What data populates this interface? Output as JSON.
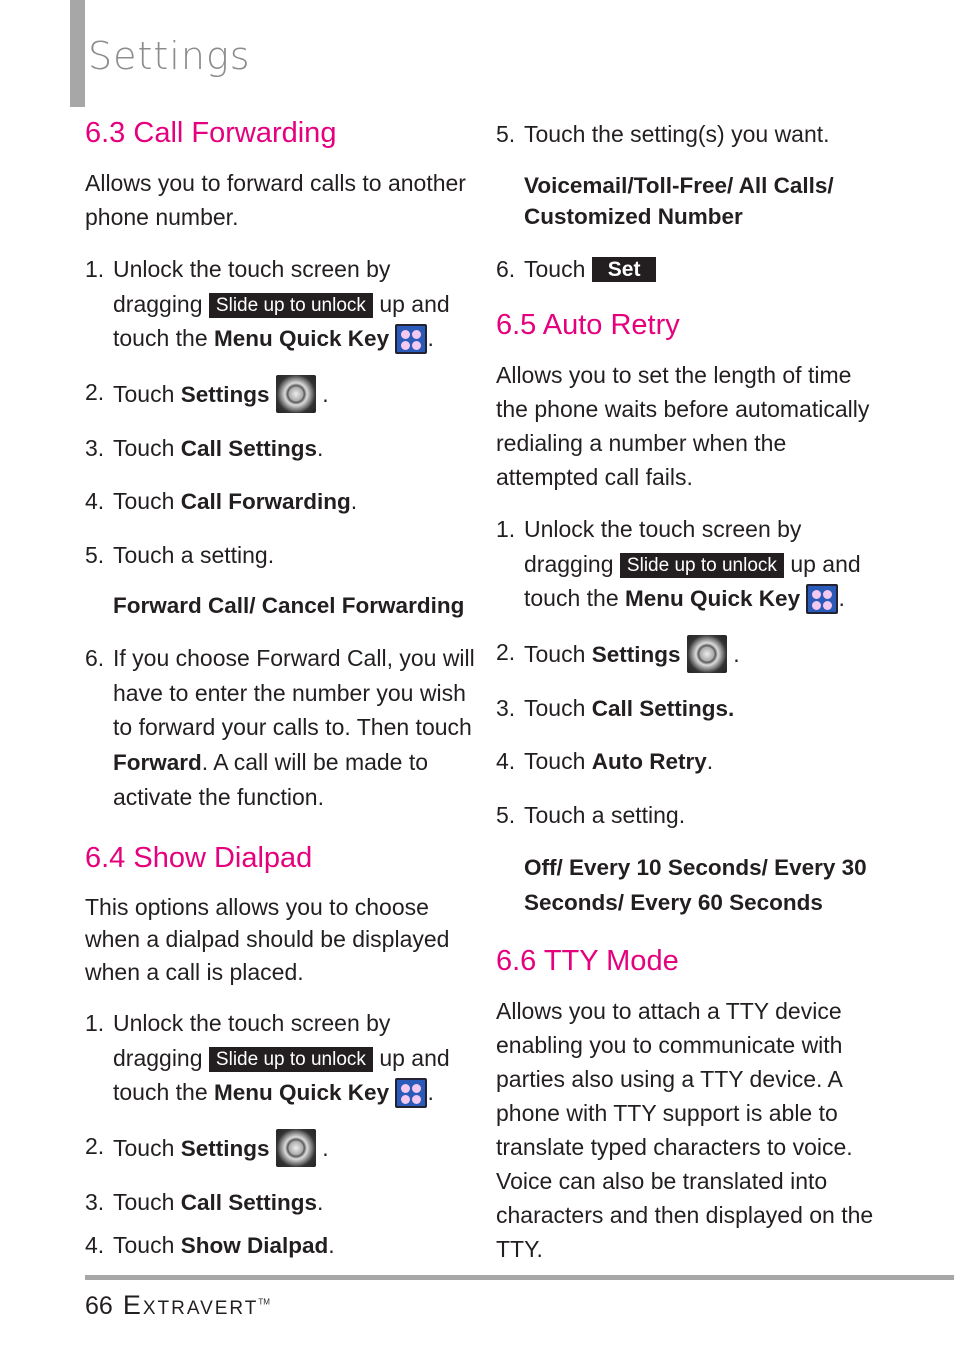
{
  "page": {
    "title": "Settings",
    "number": "66",
    "brand": "Extravert",
    "trademark": "TM"
  },
  "chips": {
    "slide": "Slide up to unlock",
    "set": "Set"
  },
  "s63": {
    "heading": "6.3 Call Forwarding",
    "intro": "Allows you to forward calls to another phone number.",
    "steps": [
      {
        "n": "1.",
        "a": "Unlock the touch screen by dragging",
        "b": "up and touch the",
        "key": "Menu Quick Key"
      },
      {
        "n": "2.",
        "a": "Touch",
        "key": "Settings"
      },
      {
        "n": "3.",
        "a": "Touch",
        "key": "Call Settings"
      },
      {
        "n": "4.",
        "a": "Touch",
        "key": "Call Forwarding"
      },
      {
        "n": "5.",
        "a": "Touch a setting."
      },
      {
        "n": "6.",
        "a": "If you choose Forward Call, you will have to enter the number you wish to forward your calls to. Then touch",
        "key": "Forward",
        "b": ". A call will be made to activate the function."
      }
    ],
    "options": "Forward Call/ Cancel Forwarding"
  },
  "s64": {
    "heading": "6.4 Show Dialpad",
    "intro": "This options allows you to choose when a dialpad should be displayed when a call is placed.",
    "steps": [
      {
        "n": "1.",
        "a": "Unlock the touch screen by dragging",
        "b": "up and touch the",
        "key": "Menu Quick Key"
      },
      {
        "n": "2.",
        "a": "Touch",
        "key": "Settings"
      },
      {
        "n": "3.",
        "a": "Touch",
        "key": "Call Settings"
      },
      {
        "n": "4.",
        "a": "Touch",
        "key": "Show Dialpad"
      }
    ]
  },
  "s63cont": {
    "steps": [
      {
        "n": "5.",
        "a": "Touch the setting(s) you want."
      },
      {
        "n": "6.",
        "a": "Touch"
      }
    ],
    "options": "Voicemail/Toll-Free/ All Calls/ Customized Number"
  },
  "s65": {
    "heading": "6.5 Auto Retry",
    "intro": "Allows you to set the length of time the phone waits before automatically redialing a number when the attempted call fails.",
    "steps": [
      {
        "n": "1.",
        "a": "Unlock the touch screen by dragging",
        "b": "up and touch the",
        "key": "Menu Quick Key"
      },
      {
        "n": "2.",
        "a": "Touch",
        "key": "Settings"
      },
      {
        "n": "3.",
        "a": "Touch",
        "key": "Call Settings."
      },
      {
        "n": "4.",
        "a": "Touch",
        "key": "Auto Retry"
      },
      {
        "n": "5.",
        "a": "Touch a setting."
      }
    ],
    "options": "Off/ Every 10 Seconds/ Every 30 Seconds/ Every 60 Seconds"
  },
  "s66": {
    "heading": "6.6 TTY Mode",
    "intro": "Allows you to attach a TTY device enabling you to communicate with parties also using a TTY device. A phone with TTY support is able to translate typed characters to voice. Voice can also be translated into characters and then displayed on the TTY."
  }
}
